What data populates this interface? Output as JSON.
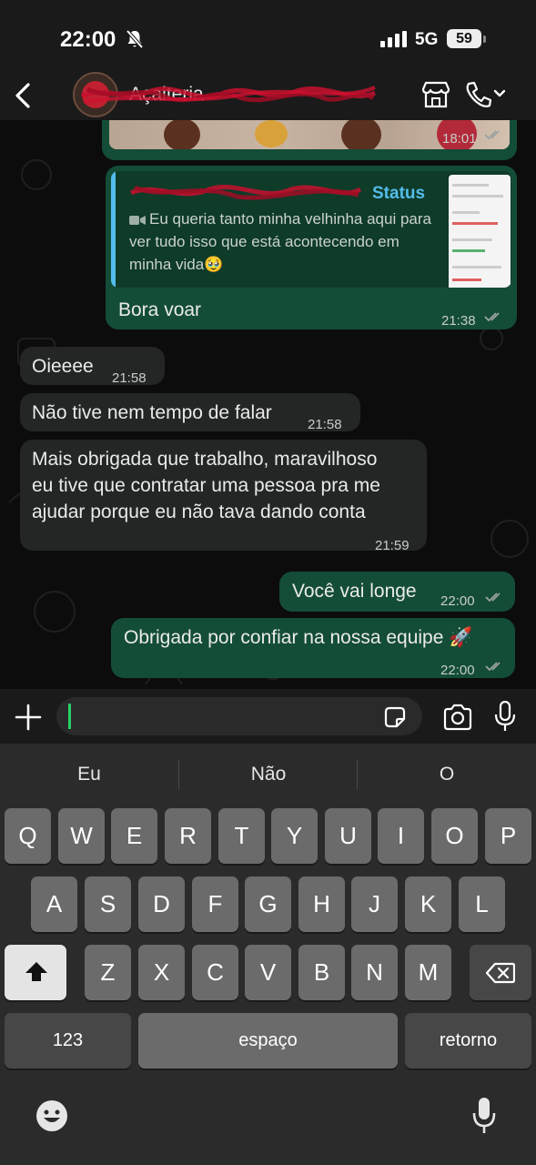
{
  "status_bar": {
    "time": "22:00",
    "network": "5G",
    "battery": "59",
    "icons": [
      "bell-muted-icon",
      "cellular-signal-icon",
      "battery-icon"
    ]
  },
  "header": {
    "contact_name": "Açaiteria",
    "icons": [
      "back-chevron-icon",
      "store-icon",
      "phone-icon",
      "chevron-down-icon"
    ]
  },
  "messages": {
    "image_time": "18:01",
    "reply": {
      "quote_author": "Status",
      "quote_text": "Eu queria tanto minha velhinha aqui para ver tudo isso que está acontecendo em minha vida🥹",
      "text": "Bora voar",
      "time": "21:38"
    },
    "m1": {
      "text": "Oieeee",
      "time": "21:58"
    },
    "m2": {
      "text": "Não tive nem tempo de falar",
      "time": "21:58"
    },
    "m3": {
      "line1": "Mais obrigada que trabalho, maravilhoso",
      "line2": "eu tive que contratar uma pessoa pra me",
      "line3": "ajudar porque eu não tava dando conta",
      "time": "21:59"
    },
    "m4": {
      "text": "Você vai longe",
      "time": "22:00"
    },
    "m5": {
      "text": "Obrigada por confiar na nossa equipe 🚀",
      "time": "22:00"
    }
  },
  "input": {
    "value": "",
    "icons": [
      "plus-icon",
      "sticker-icon",
      "camera-icon",
      "microphone-icon"
    ]
  },
  "keyboard": {
    "suggestions": [
      "Eu",
      "Não",
      "O"
    ],
    "row1": [
      "Q",
      "W",
      "E",
      "R",
      "T",
      "Y",
      "U",
      "I",
      "O",
      "P"
    ],
    "row2": [
      "A",
      "S",
      "D",
      "F",
      "G",
      "H",
      "J",
      "K",
      "L"
    ],
    "row3": [
      "Z",
      "X",
      "C",
      "V",
      "B",
      "N",
      "M"
    ],
    "numbers": "123",
    "space": "espaço",
    "return": "retorno",
    "icons": [
      "shift-icon",
      "backspace-icon",
      "emoji-icon",
      "dictation-mic-icon"
    ]
  },
  "colors": {
    "outgoing_bubble": "#144d37",
    "incoming_bubble": "#242626",
    "accent": "#25d366",
    "quote_author": "#53bdeb"
  }
}
